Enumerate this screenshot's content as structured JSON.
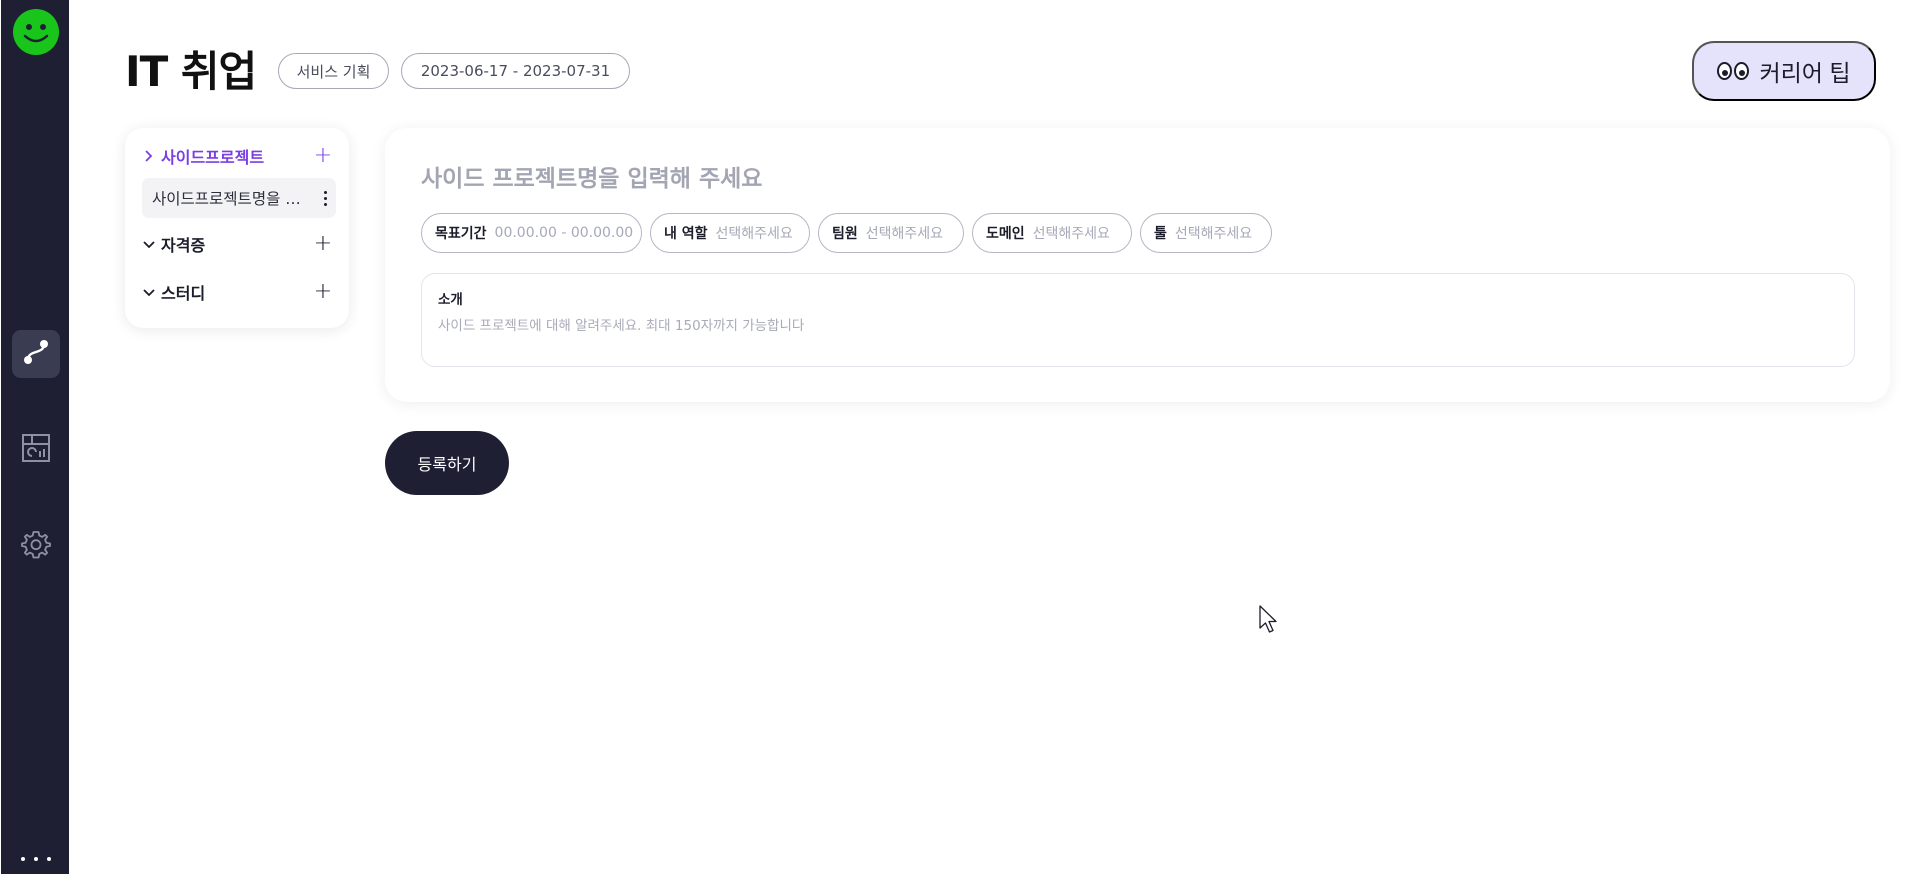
{
  "header": {
    "title": "IT 취업",
    "category_chip": "서비스 기획",
    "period_chip": "2023-06-17 - 2023-07-31",
    "tip_button": "커리어 팁"
  },
  "sidebar": {
    "icons": [
      "smile-logo-icon",
      "roadmap-icon",
      "dashboard-icon",
      "gear-icon",
      "more-icon"
    ],
    "active_index": 1
  },
  "categories": [
    {
      "label": "사이드프로젝트",
      "expanded": true,
      "items": [
        "사이드프로젝트명을 입력해 주세요"
      ]
    },
    {
      "label": "자격증",
      "expanded": false
    },
    {
      "label": "스터디",
      "expanded": false
    }
  ],
  "category_item_display": "사이드프로젝트명을 …",
  "editor": {
    "name_placeholder": "사이드 프로젝트명을 입력해 주세요",
    "fields": [
      {
        "label": "목표기간",
        "value": "00.00.00 - 00.00.00"
      },
      {
        "label": "내 역할",
        "value": "선택해주세요"
      },
      {
        "label": "팀원",
        "value": "선택해주세요"
      },
      {
        "label": "도메인",
        "value": "선택해주세요"
      },
      {
        "label": "툴",
        "value": "선택해주세요"
      }
    ],
    "intro_label": "소개",
    "intro_placeholder": "사이드 프로젝트에 대해 알려주세요. 최대 150자까지 가능합니다"
  },
  "submit_label": "등록하기",
  "colors": {
    "rail": "#1e1f33",
    "accent": "#7a3fe4",
    "tip_bg": "#e4e3fb",
    "logo": "#19c51a"
  }
}
